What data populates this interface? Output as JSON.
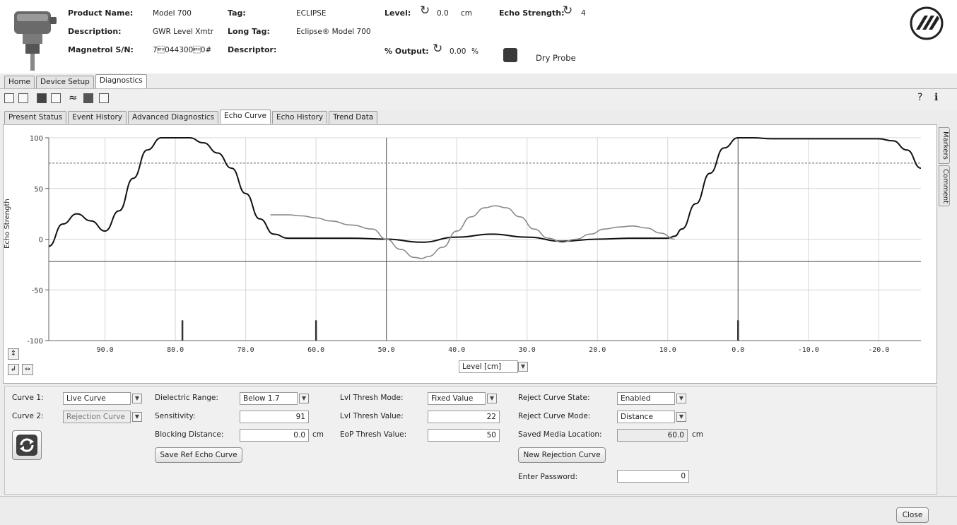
{
  "header": {
    "product_name_label": "Product Name:",
    "product_name": "Model 700",
    "description_label": "Description:",
    "description": "GWR Level Xmtr",
    "serial_label": "Magnetrol S/N:",
    "serial": "7\u0003044300\u00030#",
    "tag_label": "Tag:",
    "tag": "ECLIPSE",
    "long_tag_label": "Long Tag:",
    "long_tag": "Eclipse® Model 700",
    "descriptor_label": "Descriptor:",
    "descriptor": "",
    "level_label": "Level:",
    "level_value": "0.0",
    "level_unit": "cm",
    "echo_strength_label": "Echo Strength:",
    "echo_strength_value": "4",
    "output_label": "% Output:",
    "output_value": "0.00",
    "output_unit": "%",
    "status_text": "Dry Probe",
    "status_color": "#3a3a3a"
  },
  "main_tabs": [
    "Home",
    "Device Setup",
    "Diagnostics"
  ],
  "main_tab_active": "Diagnostics",
  "sub_tabs": [
    "Present Status",
    "Event History",
    "Advanced Diagnostics",
    "Echo Curve",
    "Echo History",
    "Trend Data"
  ],
  "sub_tab_active": "Echo Curve",
  "side_tabs": [
    "Markers",
    "Comment"
  ],
  "toolbar_icons": [
    "view-icon",
    "window-icon",
    "save-icon",
    "print-icon",
    "signal-icon",
    "image-icon",
    "chart-icon"
  ],
  "chart_data": {
    "type": "line",
    "xlabel": "",
    "ylabel": "Echo Strength",
    "x_unit_select": "Level [cm]",
    "xlim": [
      98,
      -26
    ],
    "ylim": [
      -100,
      100
    ],
    "xticks": [
      "90.0",
      "80.0",
      "70.0",
      "60.0",
      "50.0",
      "40.0",
      "30.0",
      "20.0",
      "10.0",
      "0.0",
      "-10.0",
      "-20.0"
    ],
    "xtick_values": [
      90,
      80,
      70,
      60,
      50,
      40,
      30,
      20,
      10,
      0,
      -10,
      -20
    ],
    "yticks": [
      "100",
      "50",
      "0",
      "-50",
      "-100"
    ],
    "ytick_values": [
      100,
      50,
      0,
      -50,
      -100
    ],
    "grid": true,
    "series": [
      {
        "color": "#111111",
        "x": [
          98,
          96,
          94,
          92,
          90,
          88,
          86,
          84,
          82,
          80,
          78,
          76,
          74,
          72,
          70,
          68,
          66,
          64,
          60,
          55,
          50,
          45,
          40,
          35,
          30,
          25,
          20,
          15,
          10,
          9,
          8,
          6,
          4,
          2,
          0,
          -2,
          -5,
          -10,
          -15,
          -20,
          -22,
          -24,
          -26
        ],
        "y": [
          -7,
          15,
          25,
          18,
          8,
          28,
          60,
          88,
          100,
          100,
          100,
          95,
          85,
          70,
          45,
          20,
          5,
          1,
          1,
          1,
          0,
          -3,
          2,
          5,
          2,
          -2,
          0,
          1,
          1,
          3,
          10,
          35,
          65,
          90,
          100,
          100,
          99,
          99,
          99,
          99,
          97,
          88,
          70
        ]
      },
      {
        "color": "#8a8a8a",
        "x": [
          66.5,
          64,
          62,
          60,
          58,
          55,
          52,
          50,
          48,
          46,
          45,
          44,
          42,
          40,
          38,
          36,
          34.5,
          33,
          31,
          29,
          27,
          25,
          23,
          21,
          19,
          17,
          15,
          13,
          11,
          9
        ],
        "y": [
          24,
          24,
          23,
          21,
          18,
          14,
          10,
          0,
          -10,
          -18,
          -19,
          -17,
          -8,
          8,
          22,
          31,
          33,
          31,
          22,
          10,
          1,
          -3,
          0,
          5,
          10,
          12,
          13,
          11,
          6,
          0
        ]
      }
    ],
    "threshold_lines": [
      {
        "y": 75,
        "style": "dashed",
        "color": "#666666"
      },
      {
        "y": -22,
        "style": "solid",
        "color": "#444444"
      }
    ],
    "vertical_lines": [
      50,
      0
    ],
    "markers": [
      79,
      60,
      0
    ]
  },
  "controls": {
    "curve1_label": "Curve 1:",
    "curve1_value": "Live Curve",
    "curve2_label": "Curve 2:",
    "curve2_value": "Rejection Curve",
    "dielectric_label": "Dielectric Range:",
    "dielectric_value": "Below 1.7",
    "sensitivity_label": "Sensitivity:",
    "sensitivity_value": "91",
    "blocking_label": "Blocking Distance:",
    "blocking_value": "0.0",
    "blocking_unit": "cm",
    "save_ref_label": "Save Ref Echo Curve",
    "lvl_mode_label": "Lvl Thresh Mode:",
    "lvl_mode_value": "Fixed Value",
    "lvl_value_label": "Lvl Thresh Value:",
    "lvl_value": "22",
    "eop_label": "EoP Thresh Value:",
    "eop_value": "50",
    "reject_state_label": "Reject Curve State:",
    "reject_state_value": "Enabled",
    "reject_mode_label": "Reject Curve Mode:",
    "reject_mode_value": "Distance",
    "saved_media_label": "Saved Media Location:",
    "saved_media_value": "60.0",
    "saved_media_unit": "cm",
    "new_rejection_label": "New Rejection Curve",
    "password_label": "Enter Password:",
    "password_value": "0"
  },
  "footer": {
    "close_label": "Close"
  }
}
